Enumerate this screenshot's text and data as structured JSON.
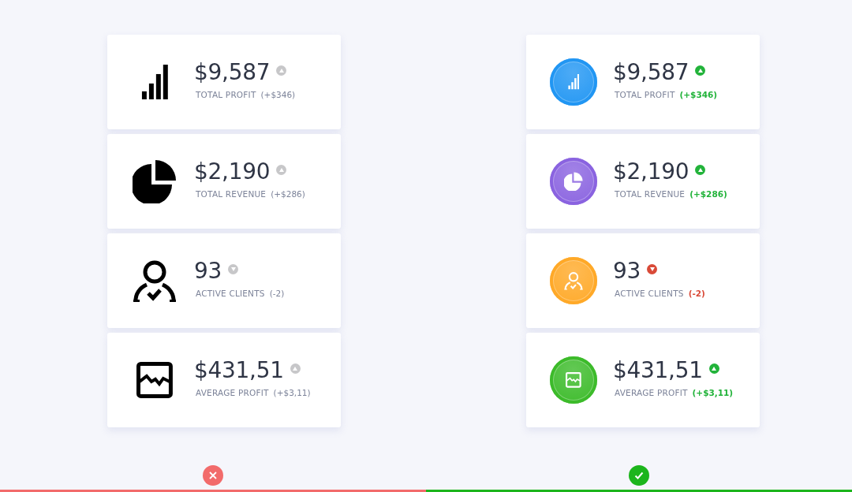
{
  "panels": [
    {
      "kind": "plain",
      "approved": false,
      "cards": [
        {
          "value": "$9,587",
          "rising": true,
          "label": "TOTAL PROFIT",
          "change": "(+$346)"
        },
        {
          "value": "$2,190",
          "rising": true,
          "label": "TOTAL REVENUE",
          "change": "(+$286)"
        },
        {
          "value": "93",
          "rising": false,
          "label": "ACTIVE CLIENTS",
          "change": "(-2)"
        },
        {
          "value": "$431,51",
          "rising": true,
          "label": "AVERAGE PROFIT",
          "change": "(+$3,11)"
        }
      ]
    },
    {
      "kind": "colored",
      "approved": true,
      "cards": [
        {
          "color": "#2196f3",
          "value": "$9,587",
          "rising": true,
          "label": "TOTAL PROFIT",
          "change": "(+$346)"
        },
        {
          "color": "#8a63e0",
          "value": "$2,190",
          "rising": true,
          "label": "TOTAL REVENUE",
          "change": "(+$286)"
        },
        {
          "color": "#ffa928",
          "value": "93",
          "rising": false,
          "label": "ACTIVE CLIENTS",
          "change": "(-2)"
        },
        {
          "color": "#3cbb2a",
          "value": "$431,51",
          "rising": true,
          "label": "AVERAGE PROFIT",
          "change": "(+$3,11)"
        }
      ]
    }
  ]
}
